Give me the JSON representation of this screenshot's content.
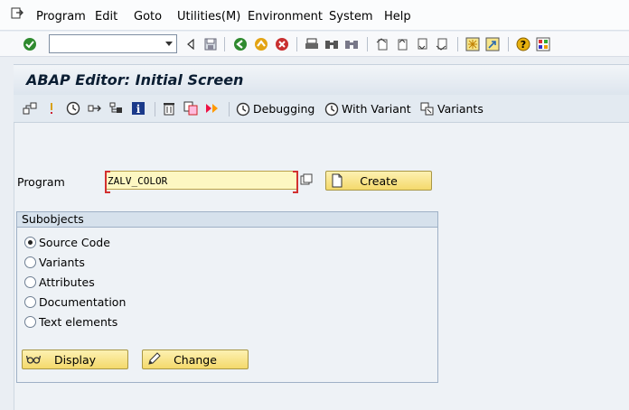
{
  "menubar": {
    "items": [
      "Program",
      "Edit",
      "Goto",
      "Utilities(M)",
      "Environment",
      "System",
      "Help"
    ]
  },
  "title": "ABAP Editor: Initial Screen",
  "app_toolbar": {
    "debugging_label": "Debugging",
    "with_variant_label": "With Variant",
    "variants_label": "Variants"
  },
  "program": {
    "label": "Program",
    "value": "ZALV_COLOR"
  },
  "buttons": {
    "create": "Create",
    "display": "Display",
    "change": "Change"
  },
  "subobjects": {
    "title": "Subobjects",
    "options": [
      "Source Code",
      "Variants",
      "Attributes",
      "Documentation",
      "Text elements"
    ],
    "selected": "Source Code"
  }
}
